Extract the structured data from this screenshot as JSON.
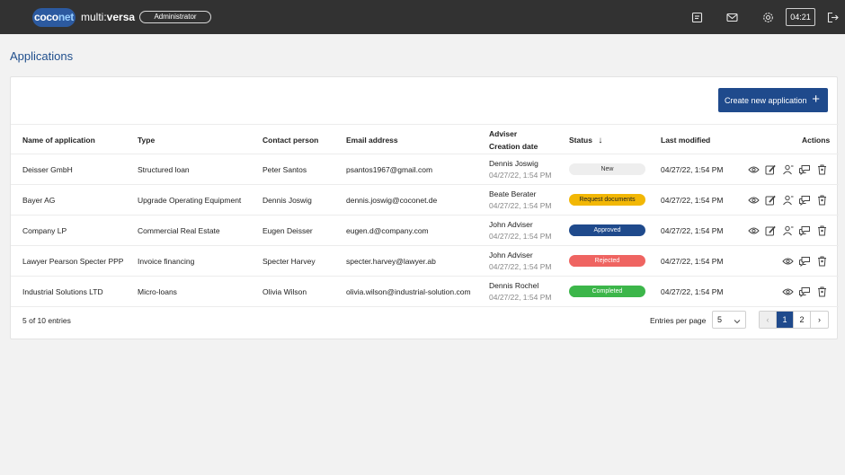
{
  "topbar": {
    "logo_pre": "coco",
    "logo_post": "net",
    "app_prefix": "multi:",
    "app_suffix": "versa",
    "role": "Administrator",
    "timer": "04:21"
  },
  "page": {
    "title": "Applications"
  },
  "toolbar": {
    "create_label": "Create new application",
    "create_plus": "+"
  },
  "table": {
    "headers": {
      "name": "Name of application",
      "type": "Type",
      "contact": "Contact person",
      "email": "Email address",
      "adviser": "Adviser",
      "creation": "Creation date",
      "status": "Status",
      "sort_arrow": "↓",
      "modified": "Last modified",
      "actions": "Actions"
    },
    "rows": [
      {
        "name": "Deisser GmbH",
        "type": "Structured loan",
        "contact": "Peter Santos",
        "email": "psantos1967@gmail.com",
        "adviser": "Dennis Joswig",
        "date": "04/27/22, 1:54 PM",
        "status": "New",
        "modified": "04/27/22, 1:54 PM"
      },
      {
        "name": "Bayer AG",
        "type": "Upgrade Operating Equipment",
        "contact": "Dennis Joswig",
        "email": "dennis.joswig@coconet.de",
        "adviser": "Beate Berater",
        "date": "04/27/22, 1:54 PM",
        "status": "Request documents",
        "modified": "04/27/22, 1:54 PM"
      },
      {
        "name": "Company LP",
        "type": "Commercial Real Estate",
        "contact": "Eugen Deisser",
        "email": "eugen.d@company.com",
        "adviser": "John Adviser",
        "date": "04/27/22, 1:54 PM",
        "status": "Approved",
        "modified": "04/27/22, 1:54 PM"
      },
      {
        "name": "Lawyer Pearson Specter PPP",
        "type": "Invoice financing",
        "contact": "Specter Harvey",
        "email": "specter.harvey@lawyer.ab",
        "adviser": "John Adviser",
        "date": "04/27/22, 1:54 PM",
        "status": "Rejected",
        "modified": "04/27/22, 1:54 PM"
      },
      {
        "name": "Industrial Solutions LTD",
        "type": "Micro-loans",
        "contact": "Olivia Wilson",
        "email": "olivia.wilson@industrial-solution.com",
        "adviser": "Dennis Rochel",
        "date": "04/27/22, 1:54 PM",
        "status": "Completed",
        "modified": "04/27/22, 1:54 PM"
      }
    ]
  },
  "status_colors": {
    "New": "#eeeeee",
    "Request documents": "#f2b705",
    "Approved": "#1f4a8c",
    "Rejected": "#ef6461",
    "Completed": "#3cb64a"
  },
  "footer": {
    "entries_count": "5 of 10 entries",
    "per_page_label": "Entries per page",
    "per_page_value": "5",
    "pages": [
      "1",
      "2"
    ],
    "prev": "‹",
    "next": "›"
  }
}
